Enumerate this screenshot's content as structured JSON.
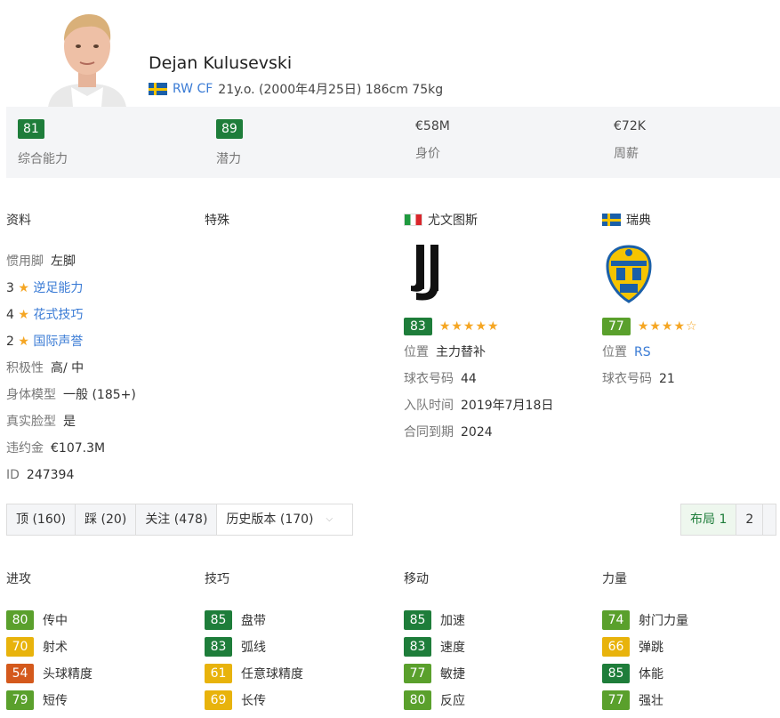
{
  "player": {
    "name": "Dejan Kulusevski",
    "positions": "RW CF",
    "details": "21y.o. (2000年4月25日) 186cm 75kg"
  },
  "stats": [
    {
      "value": "81",
      "label": "综合能力",
      "style": "badge"
    },
    {
      "value": "89",
      "label": "潜力",
      "style": "badge"
    },
    {
      "value": "€58M",
      "label": "身价",
      "style": "plain"
    },
    {
      "value": "€72K",
      "label": "周薪",
      "style": "plain"
    }
  ],
  "profile": {
    "title": "资料",
    "foot_label": "惯用脚",
    "foot_value": "左脚",
    "weak_foot_num": "3",
    "weak_foot_label": "逆足能力",
    "skill_num": "4",
    "skill_label": "花式技巧",
    "rep_num": "2",
    "rep_label": "国际声誉",
    "work_label": "积极性",
    "work_value": "高/ 中",
    "body_label": "身体模型",
    "body_value": "一般 (185+)",
    "face_label": "真实脸型",
    "face_value": "是",
    "release_label": "违约金",
    "release_value": "€107.3M",
    "id_label": "ID",
    "id_value": "247394"
  },
  "specialities": {
    "title": "特殊"
  },
  "club": {
    "name": "尤文图斯",
    "rating": "83",
    "stars": "★★★★★",
    "position_label": "位置",
    "position_value": "主力替补",
    "kit_label": "球衣号码",
    "kit_value": "44",
    "joined_label": "入队时间",
    "joined_value": "2019年7月18日",
    "contract_label": "合同到期",
    "contract_value": "2024"
  },
  "national": {
    "name": "瑞典",
    "rating": "77",
    "stars": "★★★★☆",
    "position_label": "位置",
    "position_value": "RS",
    "kit_label": "球衣号码",
    "kit_value": "21"
  },
  "tabs": {
    "like": "顶 (160)",
    "dislike": "踩 (20)",
    "follow": "关注 (478)",
    "history": "历史版本 (170)"
  },
  "pager": {
    "layout1": "布局 1",
    "page2": "2"
  },
  "colors": {
    "green_dark": "#1e7d3a",
    "green": "#5aa02c",
    "yellow": "#e8b30c",
    "orange": "#d4591c",
    "star": "#f5a623",
    "link": "#3a7bd5"
  },
  "attributes": [
    {
      "title": "进攻",
      "items": [
        {
          "value": "80",
          "name": "传中",
          "color": "#5aa02c"
        },
        {
          "value": "70",
          "name": "射术",
          "color": "#e8b30c"
        },
        {
          "value": "54",
          "name": "头球精度",
          "color": "#d4591c"
        },
        {
          "value": "79",
          "name": "短传",
          "color": "#5aa02c"
        }
      ]
    },
    {
      "title": "技巧",
      "items": [
        {
          "value": "85",
          "name": "盘带",
          "color": "#1e7d3a"
        },
        {
          "value": "83",
          "name": "弧线",
          "color": "#1e7d3a"
        },
        {
          "value": "61",
          "name": "任意球精度",
          "color": "#e8b30c"
        },
        {
          "value": "69",
          "name": "长传",
          "color": "#e8b30c"
        }
      ]
    },
    {
      "title": "移动",
      "items": [
        {
          "value": "85",
          "name": "加速",
          "color": "#1e7d3a"
        },
        {
          "value": "83",
          "name": "速度",
          "color": "#1e7d3a"
        },
        {
          "value": "77",
          "name": "敏捷",
          "color": "#5aa02c"
        },
        {
          "value": "80",
          "name": "反应",
          "color": "#5aa02c"
        }
      ]
    },
    {
      "title": "力量",
      "items": [
        {
          "value": "74",
          "name": "射门力量",
          "color": "#5aa02c"
        },
        {
          "value": "66",
          "name": "弹跳",
          "color": "#e8b30c"
        },
        {
          "value": "85",
          "name": "体能",
          "color": "#1e7d3a"
        },
        {
          "value": "77",
          "name": "强壮",
          "color": "#5aa02c"
        }
      ]
    }
  ]
}
